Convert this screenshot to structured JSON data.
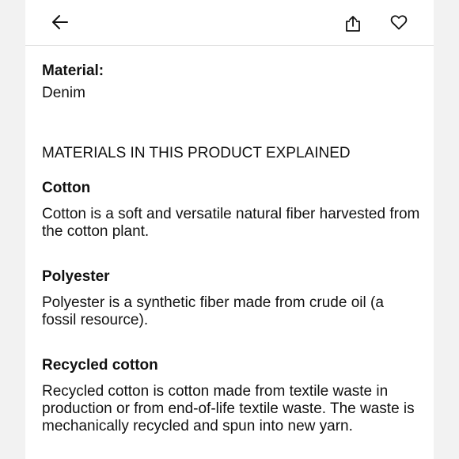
{
  "header": {
    "back_icon": "arrow-left-icon",
    "share_icon": "share-icon",
    "favorite_icon": "heart-icon"
  },
  "material": {
    "label": "Material:",
    "value": "Denim"
  },
  "explained": {
    "heading": "MATERIALS IN THIS PRODUCT EXPLAINED",
    "items": [
      {
        "title": "Cotton",
        "description": "Cotton is a soft and versatile natural fiber harvested from the cotton plant."
      },
      {
        "title": "Polyester",
        "description": "Polyester is a synthetic fiber made from crude oil (a fossil resource)."
      },
      {
        "title": "Recycled cotton",
        "description": "Recycled cotton is cotton made from textile waste in production or from end-of-life textile waste. The waste is mechanically recycled and spun into new yarn."
      }
    ]
  }
}
